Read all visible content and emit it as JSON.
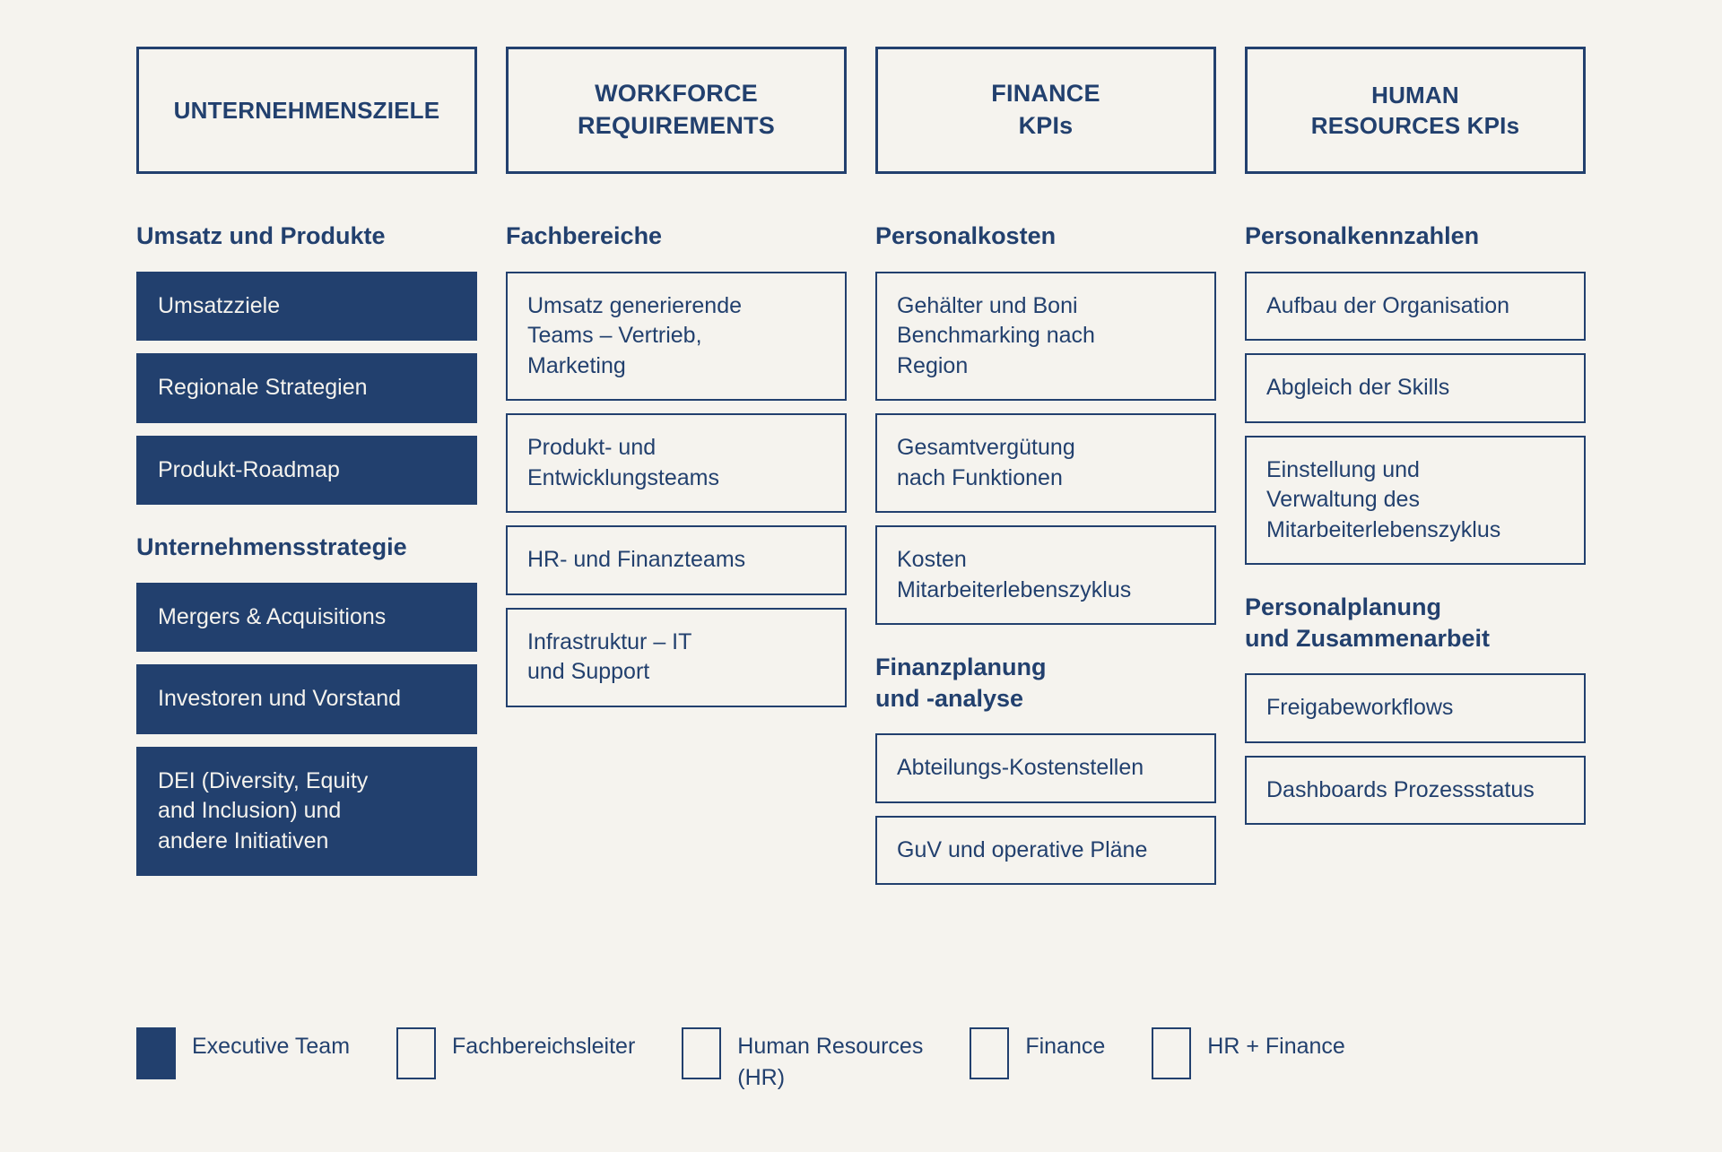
{
  "theme": {
    "background": "#F5F3EE",
    "navy": "#22406E",
    "text_on_navy": "#F5F3EE"
  },
  "columns": [
    {
      "header": "UNTERNEHMENSZIELE",
      "sections": [
        {
          "title": "Umsatz und Produkte",
          "items": [
            {
              "label": "Umsatzziele",
              "style": "filled",
              "owner": "Executive Team"
            },
            {
              "label": "Regionale Strategien",
              "style": "filled",
              "owner": "Executive Team"
            },
            {
              "label": "Produkt-Roadmap",
              "style": "filled",
              "owner": "Executive Team"
            }
          ]
        },
        {
          "title": "Unternehmensstrategie",
          "items": [
            {
              "label": "Mergers & Acquisitions",
              "style": "filled",
              "owner": "Executive Team"
            },
            {
              "label": "Investoren und Vorstand",
              "style": "filled",
              "owner": "Executive Team"
            },
            {
              "label": "DEI (Diversity, Equity\nand Inclusion) und\nandere Initiativen",
              "style": "filled",
              "owner": "Executive Team"
            }
          ]
        }
      ]
    },
    {
      "header": "WORKFORCE\nREQUIREMENTS",
      "sections": [
        {
          "title": "Fachbereiche",
          "items": [
            {
              "label": "Umsatz generierende\nTeams – Vertrieb,\nMarketing",
              "style": "outline",
              "owner": "Fachbereichsleiter"
            },
            {
              "label": "Produkt- und\nEntwicklungsteams",
              "style": "outline",
              "owner": "Fachbereichsleiter"
            },
            {
              "label": "HR- und Finanzteams",
              "style": "outline",
              "owner": "Fachbereichsleiter"
            },
            {
              "label": "Infrastruktur – IT\nund Support",
              "style": "outline",
              "owner": "Fachbereichsleiter"
            }
          ]
        }
      ]
    },
    {
      "header": "FINANCE\nKPIs",
      "sections": [
        {
          "title": "Personalkosten",
          "items": [
            {
              "label": "Gehälter und Boni\nBenchmarking nach\nRegion",
              "style": "outline",
              "owner": "Finance"
            },
            {
              "label": "Gesamtvergütung\nnach Funktionen",
              "style": "outline",
              "owner": "Finance"
            },
            {
              "label": "Kosten\nMitarbeiterlebenszyklus",
              "style": "outline",
              "owner": "Finance"
            }
          ]
        },
        {
          "title": "Finanzplanung\nund -analyse",
          "items": [
            {
              "label": "Abteilungs-Kostenstellen",
              "style": "outline",
              "owner": "Finance"
            },
            {
              "label": "GuV und operative Pläne",
              "style": "outline",
              "owner": "Finance"
            }
          ]
        }
      ]
    },
    {
      "header": "HUMAN\nRESOURCES KPIs",
      "sections": [
        {
          "title": "Personalkennzahlen",
          "items": [
            {
              "label": "Aufbau der Organisation",
              "style": "outline",
              "owner": "Human Resources (HR)"
            },
            {
              "label": "Abgleich der Skills",
              "style": "outline",
              "owner": "Human Resources (HR)"
            },
            {
              "label": "Einstellung und\nVerwaltung des\nMitarbeiterlebenszyklus",
              "style": "outline",
              "owner": "Human Resources (HR)"
            }
          ]
        },
        {
          "title": "Personalplanung\nund Zusammenarbeit",
          "items": [
            {
              "label": "Freigabeworkflows",
              "style": "outline",
              "owner": "HR + Finance"
            },
            {
              "label": "Dashboards Prozessstatus",
              "style": "outline",
              "owner": "HR + Finance"
            }
          ]
        }
      ]
    }
  ],
  "legend": [
    {
      "label": "Executive Team",
      "style": "filled"
    },
    {
      "label": "Fachbereichsleiter",
      "style": "outline"
    },
    {
      "label": "Human Resources\n(HR)",
      "style": "outline"
    },
    {
      "label": "Finance",
      "style": "outline"
    },
    {
      "label": "HR + Finance",
      "style": "outline"
    }
  ]
}
